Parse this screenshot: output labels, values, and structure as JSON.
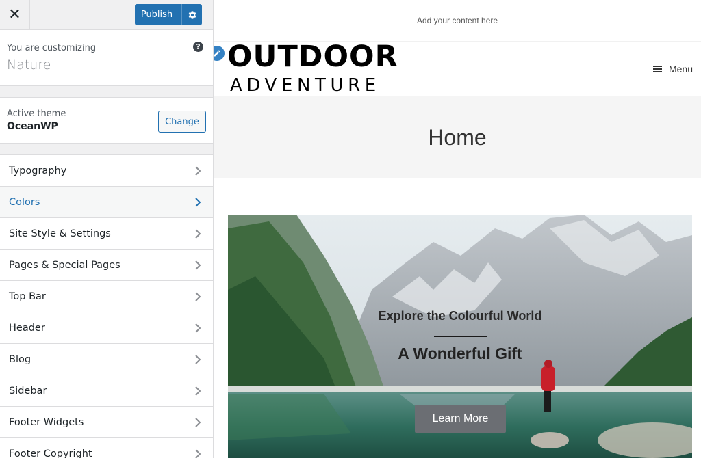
{
  "customizer": {
    "close_label": "✕",
    "publish_label": "Publish",
    "customizing_label": "You are customizing",
    "site_name": "Nature",
    "help_label": "?",
    "active_theme_label": "Active theme",
    "active_theme_name": "OceanWP",
    "change_label": "Change",
    "active_section": "Colors",
    "sections": [
      {
        "label": "Typography"
      },
      {
        "label": "Colors"
      },
      {
        "label": "Site Style & Settings"
      },
      {
        "label": "Pages & Special Pages"
      },
      {
        "label": "Top Bar"
      },
      {
        "label": "Header"
      },
      {
        "label": "Blog"
      },
      {
        "label": "Sidebar"
      },
      {
        "label": "Footer Widgets"
      },
      {
        "label": "Footer Copyright"
      }
    ],
    "accent_color": "#2271b1"
  },
  "preview": {
    "topbar_text": "Add your content here",
    "logo_line1": "OUTDOOR",
    "logo_line2": "ADVENTURE",
    "menu_label": "Menu",
    "page_title": "Home",
    "hero": {
      "subtitle": "Explore the Colourful World",
      "title": "A Wonderful Gift",
      "button_label": "Learn More"
    }
  }
}
